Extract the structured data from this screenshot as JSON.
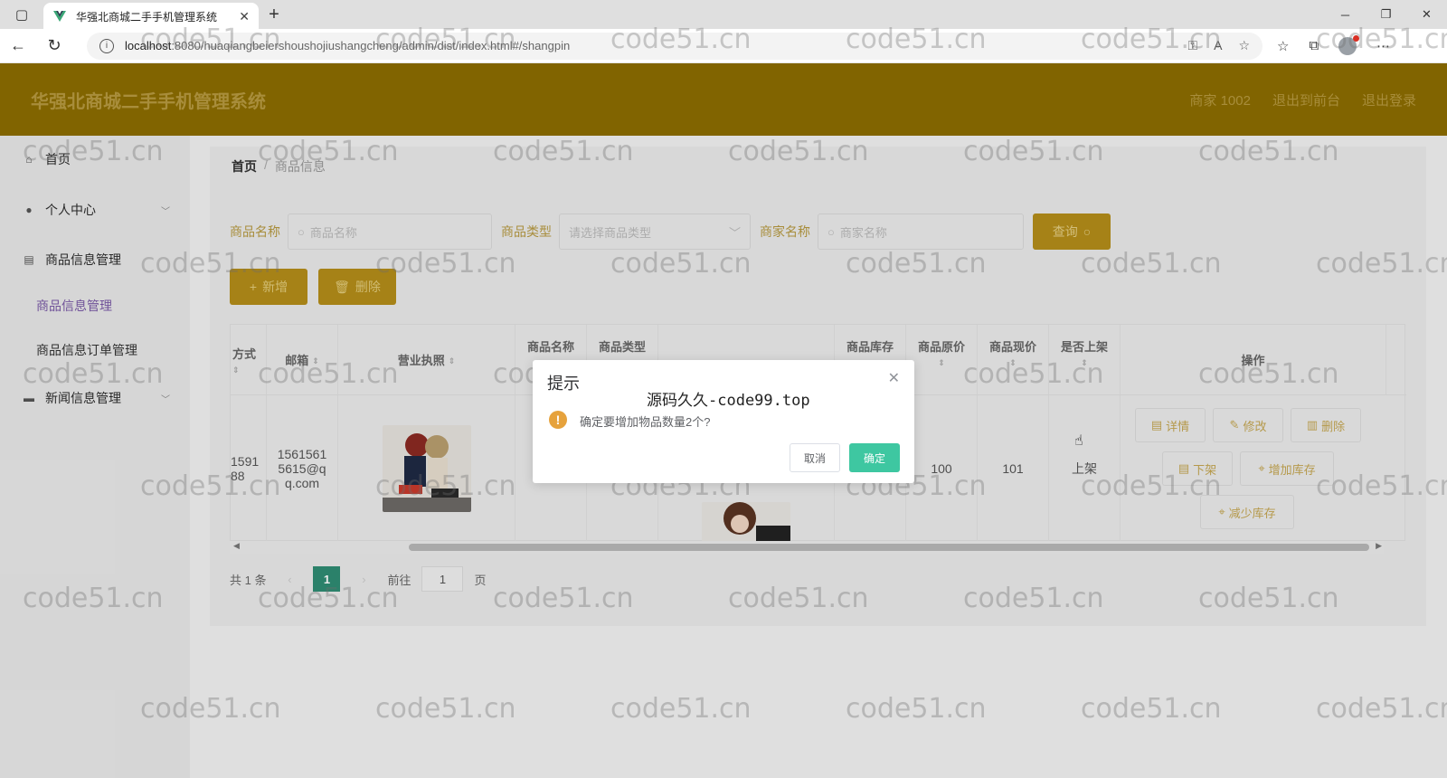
{
  "browser": {
    "tab_title": "华强北商城二手手机管理系统",
    "url_host": "localhost",
    "url_rest": ":8080/huaqiangbeiershoushojiushangcheng/admin/dist/index.html#/shangpin"
  },
  "header": {
    "app_title": "华强北商城二手手机管理系统",
    "user_label": "商家 1002",
    "exit_front": "退出到前台",
    "logout": "退出登录"
  },
  "sidebar": {
    "home": "首页",
    "personal": "个人中心",
    "goods_mgmt": "商品信息管理",
    "goods_sub": "商品信息管理",
    "orders_sub": "商品信息订单管理",
    "news_mgmt": "新闻信息管理"
  },
  "breadcrumb": {
    "home": "首页",
    "sep": "/",
    "current": "商品信息"
  },
  "filters": {
    "name_label": "商品名称",
    "name_placeholder": "商品名称",
    "type_label": "商品类型",
    "type_placeholder": "请选择商品类型",
    "merchant_label": "商家名称",
    "merchant_placeholder": "商家名称",
    "query_button": "查询"
  },
  "actions": {
    "add": "新增",
    "delete": "删除"
  },
  "table": {
    "headers": {
      "contact": "方式",
      "email": "邮箱",
      "license": "营业执照",
      "goods_name": "商品名称",
      "goods_type": "商品类型",
      "stock": "商品库存",
      "orig_price": "商品原价",
      "cur_price": "商品现价",
      "on_shelf": "是否上架",
      "ops": "操作"
    },
    "row": {
      "contact_line1": "1591",
      "contact_line2": "88",
      "email_line1": "1561561",
      "email_line2": "5615@q",
      "email_line3": "q.com",
      "stock": "",
      "orig_price": "100",
      "cur_price": "101",
      "on_shelf": "上架"
    },
    "op_buttons": {
      "detail": "详情",
      "edit": "修改",
      "delete": "删除",
      "unshelf": "下架",
      "add_stock": "增加库存",
      "reduce_stock": "减少库存"
    }
  },
  "pagination": {
    "total": "共 1 条",
    "current_page": "1",
    "goto": "前往",
    "goto_value": "1",
    "page_unit": "页"
  },
  "dialog": {
    "title": "提示",
    "watermark": "源码久久-code99.top",
    "message": "确定要增加物品数量2个?",
    "cancel": "取消",
    "confirm": "确定"
  },
  "watermark_text": "code51.cn",
  "colors": {
    "header_bg": "#8c6d00",
    "accent": "#b58e1a",
    "confirm": "#3ec7a1",
    "pager_active": "#2f8d73"
  }
}
